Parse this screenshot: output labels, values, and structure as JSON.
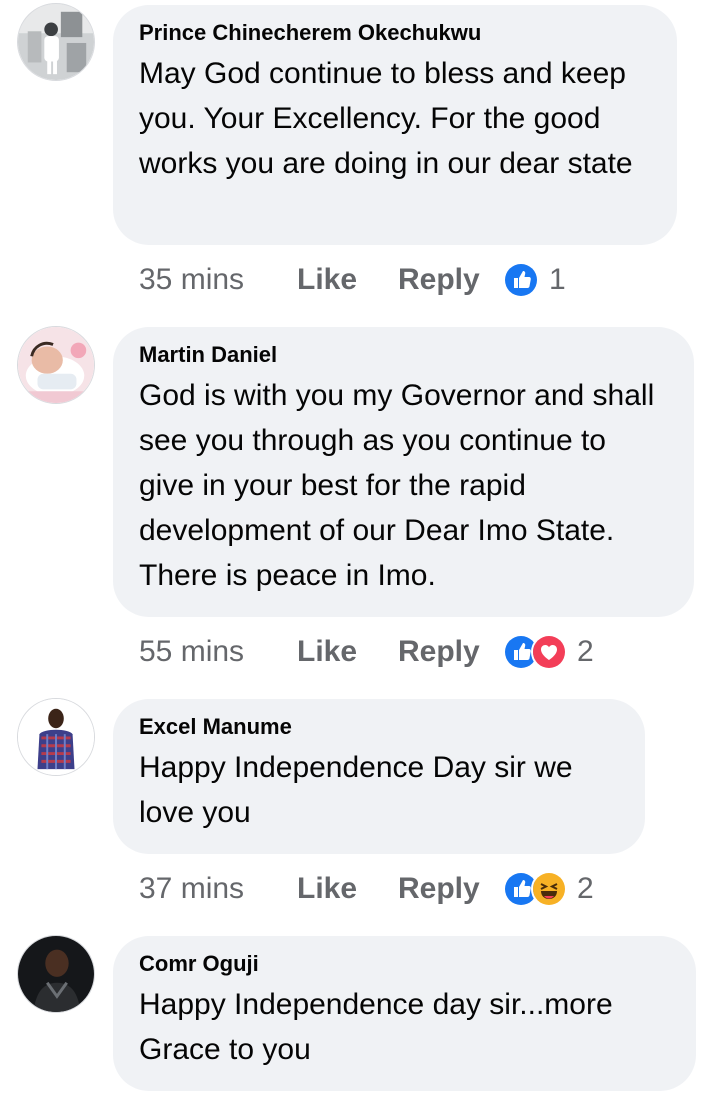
{
  "comments": [
    {
      "author": "Prince Chinecherem Okechukwu",
      "text": "May God continue to bless and keep you. Your Excellency. For the good works you are doing in our dear state",
      "time": "35 mins",
      "like_label": "Like",
      "reply_label": "Reply",
      "reactions": [
        "like-icon"
      ],
      "reaction_count": "1"
    },
    {
      "author": "Martin Daniel",
      "text": "God is with you my Governor and shall see you through as you continue to give in your best for the rapid development of our Dear Imo State. There is peace in Imo.",
      "time": "55 mins",
      "like_label": "Like",
      "reply_label": "Reply",
      "reactions": [
        "like-icon",
        "love-icon"
      ],
      "reaction_count": "2"
    },
    {
      "author": "Excel Manume",
      "text": "Happy Independence Day sir we love you",
      "time": "37 mins",
      "like_label": "Like",
      "reply_label": "Reply",
      "reactions": [
        "like-icon",
        "haha-icon"
      ],
      "reaction_count": "2"
    },
    {
      "author": "Comr Oguji",
      "text": "Happy Independence day sir...more Grace to you",
      "time": "",
      "like_label": "",
      "reply_label": "",
      "reactions": [],
      "reaction_count": ""
    }
  ],
  "colors": {
    "bubble": "#f0f2f5",
    "meta": "#65676b",
    "like_blue": "#1877f2",
    "love_red": "#f33e58",
    "haha_yellow": "#f7b125"
  }
}
